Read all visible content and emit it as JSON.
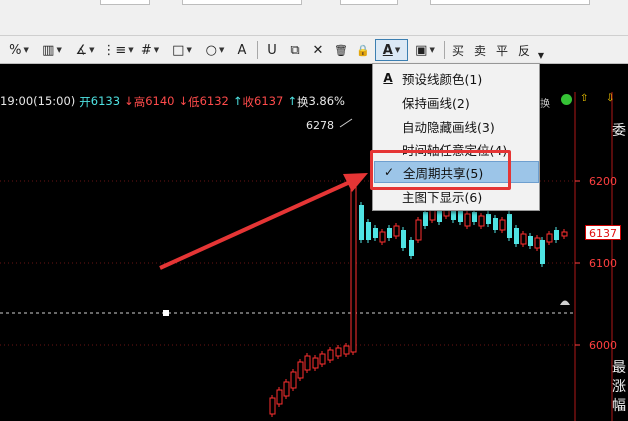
{
  "toolbar": {
    "items": [
      {
        "icon": "percent-icon",
        "glyph": "%"
      },
      {
        "icon": "bar-grid-icon",
        "glyph": "▥"
      },
      {
        "icon": "angle-icon",
        "glyph": "∡"
      },
      {
        "icon": "bracket-lines-icon",
        "glyph": "⋮≡"
      },
      {
        "icon": "hash-icon",
        "glyph": "#"
      },
      {
        "icon": "rectangle-icon",
        "glyph": "□"
      },
      {
        "icon": "circle-icon",
        "glyph": "○"
      },
      {
        "icon": "text-icon",
        "glyph": "A"
      },
      {
        "icon": "magnet-icon",
        "glyph": "U"
      },
      {
        "icon": "copy-icon",
        "glyph": "⧉"
      },
      {
        "icon": "delete-icon",
        "glyph": "✕"
      },
      {
        "icon": "trash-icon",
        "glyph": "🗑"
      },
      {
        "icon": "lock-icon",
        "glyph": "🔒"
      },
      {
        "icon": "line-color-icon",
        "glyph": "A"
      },
      {
        "icon": "save-icon",
        "glyph": "▣"
      }
    ],
    "buy_label": "买",
    "sell_label": "卖",
    "flat_label": "平",
    "reverse_label": "反"
  },
  "quote": {
    "time": "19:00(15:00)",
    "open_label": "开",
    "open": "6133",
    "high_label": "高",
    "high": "6140",
    "low_label": "低",
    "low": "6132",
    "close_label": "收",
    "close": "6137",
    "turnover_label": "换",
    "turnover": "3.86%"
  },
  "chart": {
    "max_label": "6278",
    "last_price": "6137",
    "y_ticks": [
      "6200",
      "6100",
      "6000"
    ],
    "right_edge_chars": [
      "委",
      "最",
      "涨",
      "幅"
    ]
  },
  "menu": {
    "items": [
      {
        "label": "预设线颜色(1)",
        "icon": "line-color-icon",
        "selected": false
      },
      {
        "label": "保持画线(2)",
        "icon": "",
        "selected": false
      },
      {
        "label": "自动隐藏画线(3)",
        "icon": "",
        "selected": false
      },
      {
        "label": "时间轴任意定位(4)",
        "icon": "",
        "selected": false
      },
      {
        "label": "全周期共享(5)",
        "icon": "check-icon",
        "selected": true
      },
      {
        "label": "主图下显示(6)",
        "icon": "",
        "selected": false
      }
    ]
  },
  "colors": {
    "up": "#ff3030",
    "down": "#4fe3e3",
    "annotation": "#e53535",
    "menu_selected": "#9cc5e8"
  }
}
